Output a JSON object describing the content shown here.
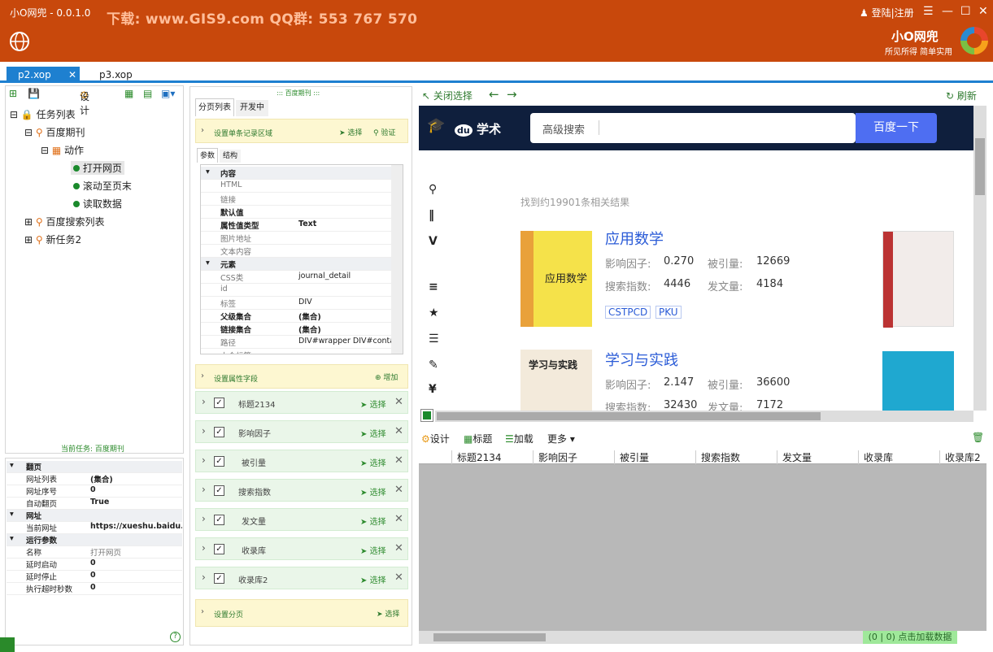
{
  "window": {
    "title": "小O网兜 - 0.0.1.0",
    "ad": "下载: www.GIS9.com  QQ群: 553 767 570",
    "login": "登陆|注册",
    "brand": "小O网兜",
    "slogan": "所见所得 简单实用"
  },
  "tabs": [
    {
      "label": "p2.xop"
    },
    {
      "label": "p3.xop"
    }
  ],
  "left_toolbar": {
    "design": "设计"
  },
  "tree": {
    "root": "任务列表",
    "n1": "百度期刊",
    "n1a": "动作",
    "n1a1": "打开网页",
    "n1a2": "滚动至页末",
    "n1a3": "读取数据",
    "n2": "百度搜索列表",
    "n3": "新任务2"
  },
  "current_task": "当前任务: 百度期刊",
  "props": {
    "s1": "翻页",
    "r1k": "网址列表",
    "r1v": "(集合)",
    "r2k": "网址序号",
    "r2v": "0",
    "r3k": "自动翻页",
    "r3v": "True",
    "s2": "网址",
    "r4k": "当前网址",
    "r4v": "https://xueshu.baidu.com",
    "s3": "运行参数",
    "r5k": "名称",
    "r5v": "打开网页",
    "r6k": "延时启动",
    "r6v": "0",
    "r7k": "延时停止",
    "r7v": "0",
    "r8k": "执行超时秒数",
    "r8v": "0"
  },
  "mid": {
    "caption": "::: 百度期刊 :::",
    "tab1": "分页列表",
    "tab2": "开发中",
    "setregion": "设置单条记录区域",
    "select": "选择",
    "verify": "验证",
    "ptab1": "参数",
    "ptab2": "结构",
    "grid": [
      {
        "k": "内容",
        "v": ""
      },
      {
        "k": "HTML",
        "v": ""
      },
      {
        "k": "链接",
        "v": ""
      },
      {
        "k": "默认值",
        "v": ""
      },
      {
        "k": "属性值类型",
        "v": "Text"
      },
      {
        "k": "图片地址",
        "v": ""
      },
      {
        "k": "文本内容",
        "v": ""
      },
      {
        "k": "元素",
        "v": ""
      },
      {
        "k": "CSS类",
        "v": "journal_detail"
      },
      {
        "k": "id",
        "v": ""
      },
      {
        "k": "标签",
        "v": "DIV"
      },
      {
        "k": "父级集合",
        "v": "(集合)"
      },
      {
        "k": "链接集合",
        "v": "(集合)"
      },
      {
        "k": "路径",
        "v": "DIV#wrapper DIV#contain"
      },
      {
        "k": "上个标签",
        "v": ""
      }
    ],
    "fieldsTitle": "设置属性字段",
    "add": "增加",
    "fields": [
      "标题2134",
      "影响因子",
      "被引量",
      "搜索指数",
      "发文量",
      "收录库",
      "收录库2"
    ],
    "paging": "设置分页"
  },
  "browser_toolbar": {
    "close": "关闭选择",
    "refresh": "刷新"
  },
  "browser": {
    "logo": "学术",
    "search_ph": "高级搜索",
    "search_btn": "百度一下",
    "results": "找到约19901条相关结果",
    "j1": {
      "name": "应用数学",
      "if_k": "影响因子:",
      "if_v": "0.270",
      "c_k": "被引量:",
      "c_v": "12669",
      "s_k": "搜索指数:",
      "s_v": "4446",
      "p_k": "发文量:",
      "p_v": "4184",
      "t1": "CSTPCD",
      "t2": "PKU"
    },
    "j2": {
      "name": "学习与实践",
      "if_k": "影响因子:",
      "if_v": "2.147",
      "c_k": "被引量:",
      "c_v": "36600",
      "s_k": "搜索指数:",
      "s_v": "32430",
      "p_k": "发文量:",
      "p_v": "7172"
    }
  },
  "bottom_toolbar": {
    "design": "设计",
    "title": "标题",
    "load": "加载",
    "more": "更多"
  },
  "table_headers": [
    "标题2134",
    "影响因子",
    "被引量",
    "搜索指数",
    "发文量",
    "收录库",
    "收录库2"
  ],
  "status": "(0 | 0) 点击加载数据"
}
